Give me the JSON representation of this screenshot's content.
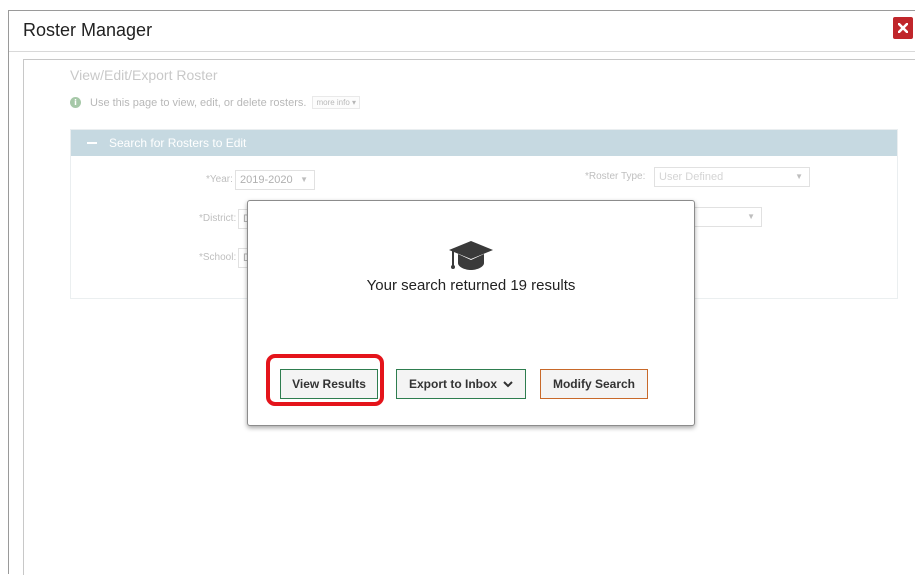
{
  "window": {
    "title": "Roster Manager"
  },
  "page": {
    "title": "View/Edit/Export Roster",
    "info_text": "Use this page to view, edit, or delete rosters.",
    "more_info": "more info",
    "panel_title": "Search for Rosters to Edit",
    "fields": {
      "year_label": "*Year:",
      "year_value": "2019-2020",
      "roster_type_label": "*Roster Type:",
      "roster_type_value": "User Defined",
      "district_label": "*District:",
      "district_value": "D",
      "school_label": "*School:",
      "school_value": "D"
    }
  },
  "modal": {
    "message": "Your search returned 19 results",
    "view_results_label": "View Results",
    "export_label": "Export to Inbox",
    "modify_label": "Modify Search",
    "icons": [
      "graduation-cap-icon",
      "chevron-down-icon"
    ]
  },
  "colors": {
    "close": "#c0262b",
    "panel_header": "#7aa7b8",
    "green_border": "#2e7d4f",
    "orange_border": "#c8692a",
    "highlight": "#e4141b"
  }
}
